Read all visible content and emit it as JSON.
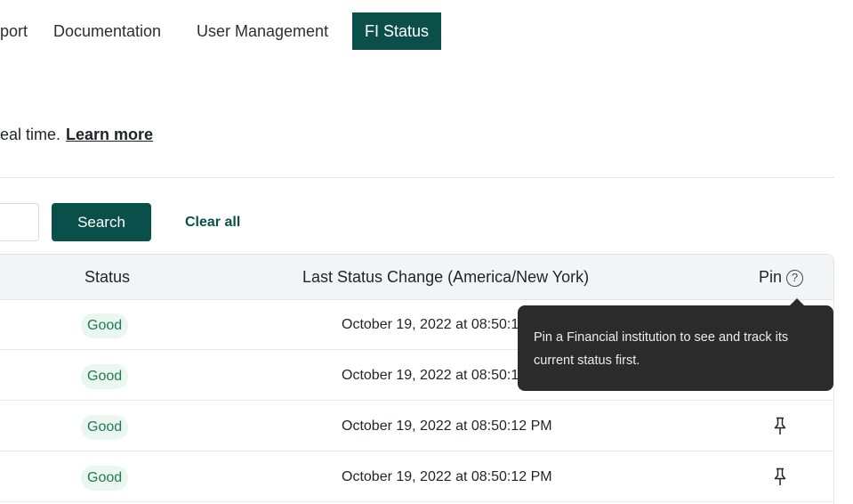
{
  "nav": {
    "items": [
      {
        "label": "port"
      },
      {
        "label": "Documentation"
      },
      {
        "label": "User Management"
      },
      {
        "label": "FI Status",
        "active": true
      }
    ]
  },
  "description": {
    "text": "eal time.",
    "link": "Learn more"
  },
  "search": {
    "input_value": "",
    "button_label": "Search",
    "clear_label": "Clear all"
  },
  "table": {
    "headers": {
      "status": "Status",
      "last_change": "Last Status Change (America/New York)",
      "pin": "Pin"
    },
    "help_icon_glyph": "?",
    "rows": [
      {
        "status": "Good",
        "last_change": "October 19, 2022 at 08:50:12 PM",
        "pinned": true
      },
      {
        "status": "Good",
        "last_change": "October 19, 2022 at 08:50:12 PM",
        "pinned": true
      },
      {
        "status": "Good",
        "last_change": "October 19, 2022 at 08:50:12 PM",
        "pinned": false
      },
      {
        "status": "Good",
        "last_change": "October 19, 2022 at 08:50:12 PM",
        "pinned": false
      }
    ]
  },
  "tooltip": {
    "line1": "Pin a Financial institution to see and track its",
    "line2": "current status first."
  },
  "colors": {
    "brand": "#0b4f4a",
    "good_badge_bg": "#eaf6f0",
    "good_badge_text": "#1f7a52",
    "tooltip_bg": "#2b2b2b"
  },
  "icons": {
    "pin_filled": "pin-filled-icon",
    "pin_outline": "pin-outline-icon",
    "help": "help-circle-icon"
  }
}
